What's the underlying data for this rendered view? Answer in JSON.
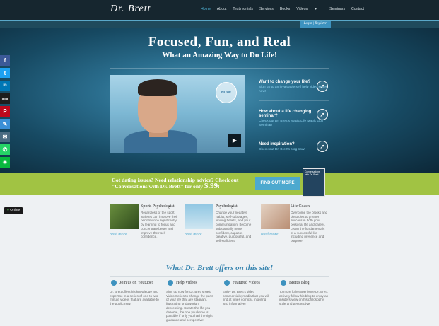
{
  "nav": {
    "logo": "Dr. Brett",
    "items": [
      "Home",
      "About",
      "Testimonials",
      "Services",
      "Books",
      "Videos",
      "Seminars",
      "Contact"
    ],
    "active_index": 0,
    "dropdown_caret": "▾"
  },
  "login": {
    "login_label": "Login",
    "separator": "|",
    "register_label": "Register"
  },
  "hero": {
    "title": "Focused, Fun, and Real",
    "subtitle": "What an Amazing Way to Do Life!",
    "video": {
      "badge": "NOW!",
      "play_icon": "▶"
    },
    "side": [
      {
        "title": "Want to change your life?",
        "text": "Sign up to an invaluable self help video series now!"
      },
      {
        "title": "How about a life changing seminar?",
        "text": "Check out Dr. Brett's Magic Life Magic Golf Seminar!"
      },
      {
        "title": "Need inspiration?",
        "text": "Check out Dr. Brett's blog now!"
      }
    ],
    "arrow_icon": "➚"
  },
  "promo": {
    "line1": "Got dating issues? Need relationship advice? Check out",
    "line2_before": "\"Conversations with Dr. Brett\" for only",
    "price": "$.99",
    "price_suffix": "!",
    "button": "FIND OUT MORE",
    "book_title": "Conversations with Dr. Brett"
  },
  "social": {
    "icons": [
      "facebook-icon",
      "twitter-icon",
      "linkedin-icon",
      "digg-icon",
      "pinterest-icon",
      "share-icon",
      "email-icon",
      "whatsapp-icon",
      "wechat-icon"
    ],
    "glyphs": [
      "f",
      "t",
      "in",
      "digg",
      "P",
      "✎",
      "✉",
      "✆",
      "✳"
    ]
  },
  "online": {
    "dot": "●",
    "label": "Online"
  },
  "services": [
    {
      "title": "Sports Psychologist",
      "text": "Regardless of the sport, athletes can improve their performance significantly by learning to focus and concentrate better and improve their self-confidence.",
      "readmore": "read more"
    },
    {
      "title": "Psychologist",
      "text": "Change your negative habits, self-sabotages, limiting beliefs, and your communication. Become substantially more confident, capable, creative, purposeful, and self-sufficient!",
      "readmore": "read more"
    },
    {
      "title": "Life Coach",
      "text": "Overcome the blocks and obstacles to greater success in both your personal life and career. Learn the fundamentals of a successful life including presence and purpose.",
      "readmore": "read more"
    }
  ],
  "offers": {
    "title": "What Dr. Brett offers on this site!",
    "items": [
      {
        "title": "Join us on Youtube!",
        "text": "Dr. Brett offers his knowledge and expertise in a series of one to two minute videos that are available to the public now!"
      },
      {
        "title": "Help Videos",
        "text": "Sign up now for Dr. Brett's Help Video Series to change the parts of your life that are stagnant, frustrating or downright depressing. Create the life you deserve, the one you know is possible if only you had the right guidance and perspective!"
      },
      {
        "title": "Featured Videos",
        "text": "Enjoy Dr. Brett's video commercials; media that you will find at times comical, inspiring and informative!"
      },
      {
        "title": "Brett's Blog",
        "text": "To more fully experience Dr. Brett, actively follow his blog to enjoy an insiders view on his philosophy, style and perspective!"
      }
    ]
  }
}
